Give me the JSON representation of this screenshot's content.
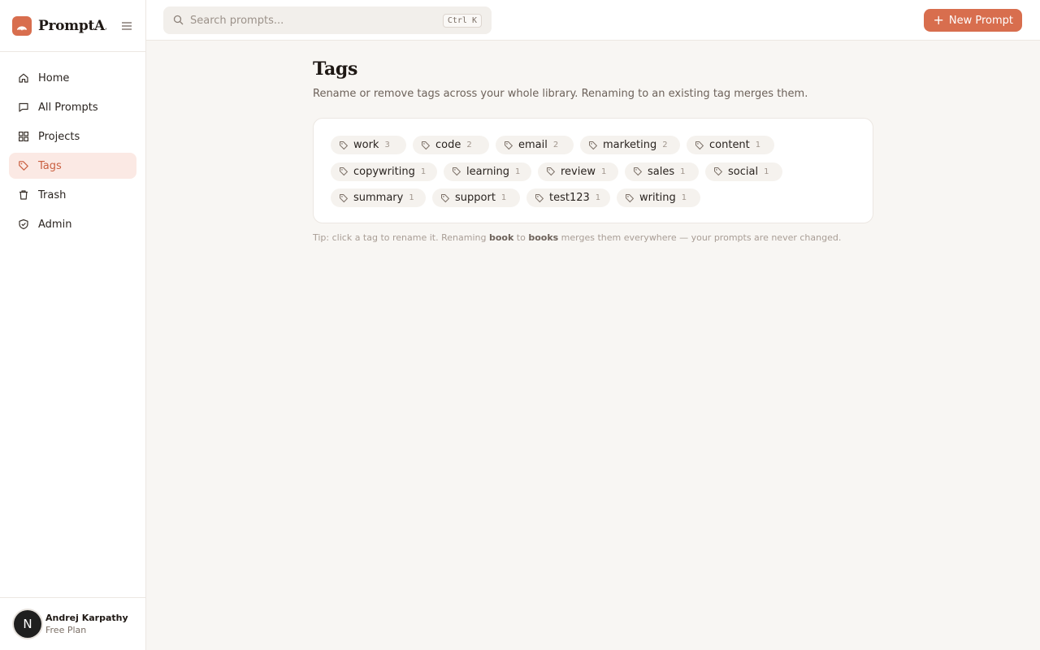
{
  "app": {
    "name": "PromptA..."
  },
  "search": {
    "placeholder": "Search prompts...",
    "shortcut": "Ctrl K"
  },
  "header": {
    "new_prompt_label": "New Prompt"
  },
  "sidebar": {
    "items": [
      {
        "label": "Home",
        "icon": "home-icon"
      },
      {
        "label": "All Prompts",
        "icon": "message-icon"
      },
      {
        "label": "Projects",
        "icon": "grid-icon"
      },
      {
        "label": "Tags",
        "icon": "tag-icon",
        "active": true
      },
      {
        "label": "Trash",
        "icon": "trash-icon"
      },
      {
        "label": "Admin",
        "icon": "shield-icon"
      }
    ]
  },
  "user": {
    "initial": "N",
    "name": "Andrej Karpathy",
    "plan": "Free Plan"
  },
  "page": {
    "title": "Tags",
    "subtitle": "Rename or remove tags across your whole library. Renaming to an existing tag merges them.",
    "tip_prefix": "Tip: click a tag to rename it. Renaming ",
    "tip_word1": "book",
    "tip_mid": " to ",
    "tip_word2": "books",
    "tip_suffix": " merges them everywhere — your prompts are never changed."
  },
  "tags": [
    {
      "name": "work",
      "count": "3"
    },
    {
      "name": "code",
      "count": "2"
    },
    {
      "name": "email",
      "count": "2"
    },
    {
      "name": "marketing",
      "count": "2"
    },
    {
      "name": "content",
      "count": "1"
    },
    {
      "name": "copywriting",
      "count": "1"
    },
    {
      "name": "learning",
      "count": "1"
    },
    {
      "name": "review",
      "count": "1"
    },
    {
      "name": "sales",
      "count": "1"
    },
    {
      "name": "social",
      "count": "1"
    },
    {
      "name": "summary",
      "count": "1"
    },
    {
      "name": "support",
      "count": "1"
    },
    {
      "name": "test123",
      "count": "1"
    },
    {
      "name": "writing",
      "count": "1"
    }
  ],
  "colors": {
    "accent": "#d86e4e",
    "active_bg": "#fbe9e4",
    "page_bg": "#f8f6f3"
  }
}
